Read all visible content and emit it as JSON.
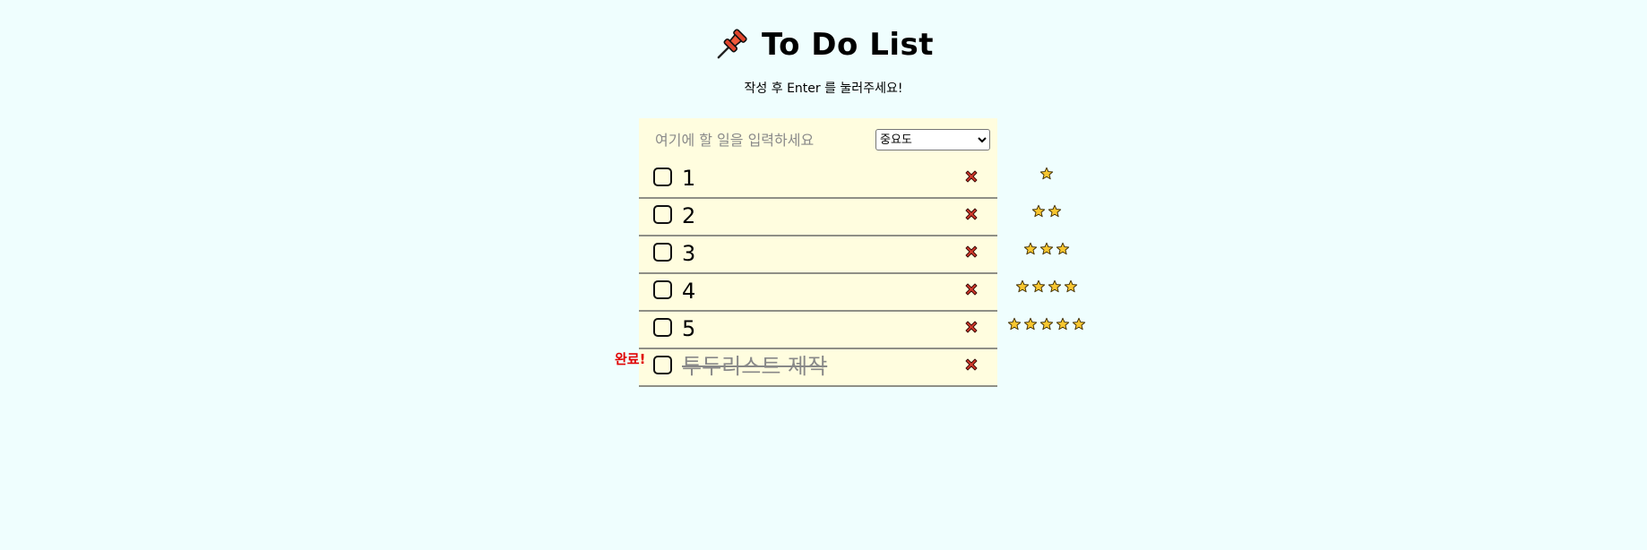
{
  "header": {
    "title": "To Do List",
    "subtitle": "작성 후 Enter 를 눌러주세요!"
  },
  "input": {
    "placeholder": "여기에 할 일을 입력하세요",
    "value": ""
  },
  "priority_select": {
    "selected": "중요도"
  },
  "todos": [
    {
      "text": "1",
      "stars": 1,
      "done": false
    },
    {
      "text": "2",
      "stars": 2,
      "done": false
    },
    {
      "text": "3",
      "stars": 3,
      "done": false
    },
    {
      "text": "4",
      "stars": 4,
      "done": false
    },
    {
      "text": "5",
      "stars": 5,
      "done": false
    },
    {
      "text": "투두리스트 제작",
      "stars": 0,
      "done": true
    }
  ],
  "done_label": "완료!",
  "colors": {
    "background": "#effefe",
    "panel": "#fffddf",
    "delete_icon": "#d33a2c",
    "star_fill": "#f8c630",
    "done_label": "#e00000"
  },
  "icons": {
    "title_icon": "pushpin-icon",
    "delete_icon": "cross-mark-icon",
    "priority_icon": "star-icon"
  }
}
